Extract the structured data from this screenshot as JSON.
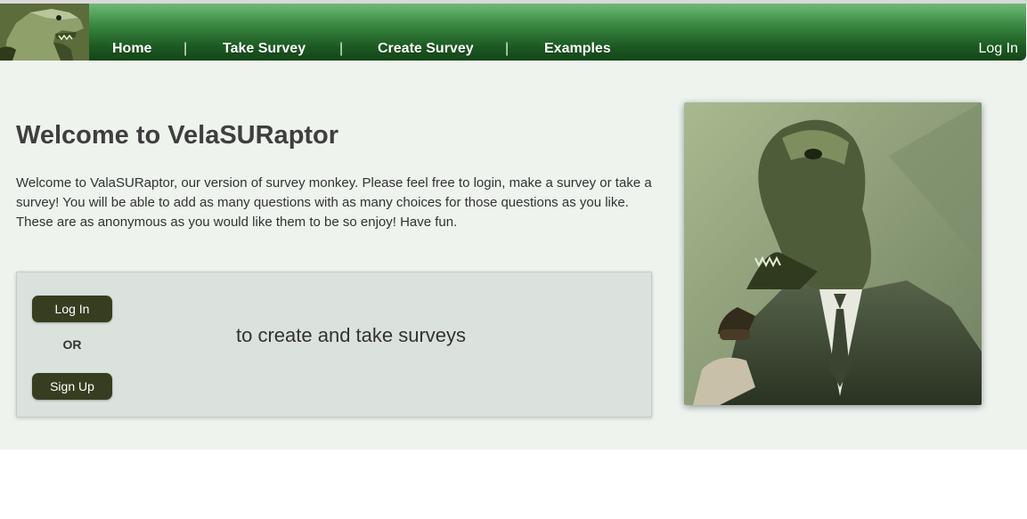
{
  "nav": {
    "items": [
      {
        "label": "Home"
      },
      {
        "label": "Take Survey"
      },
      {
        "label": "Create Survey"
      },
      {
        "label": "Examples"
      }
    ],
    "separator": "|",
    "login_label": "Log In",
    "logo_icon": "raptor-logo-icon"
  },
  "main": {
    "title": "Welcome to VelaSURaptor",
    "intro": "Welcome to ValaSURaptor, our version of survey monkey. Please feel free to login, make a survey or take a survey! You will be able to add as many questions with as many choices for those questions as you like. These are as anonymous as you would like them to be so enjoy! Have fun.",
    "auth_box": {
      "login_label": "Log In",
      "or_label": "OR",
      "signup_label": "Sign Up",
      "caption": "to create and take surveys"
    },
    "photo_icon": "raptor-in-suit-photo"
  },
  "colors": {
    "nav_green_dark": "#134617",
    "nav_green_light": "#6dbb74",
    "content_bg": "#eef3ee",
    "box_bg": "#dbe1dc",
    "button_bg": "#373d1f"
  }
}
